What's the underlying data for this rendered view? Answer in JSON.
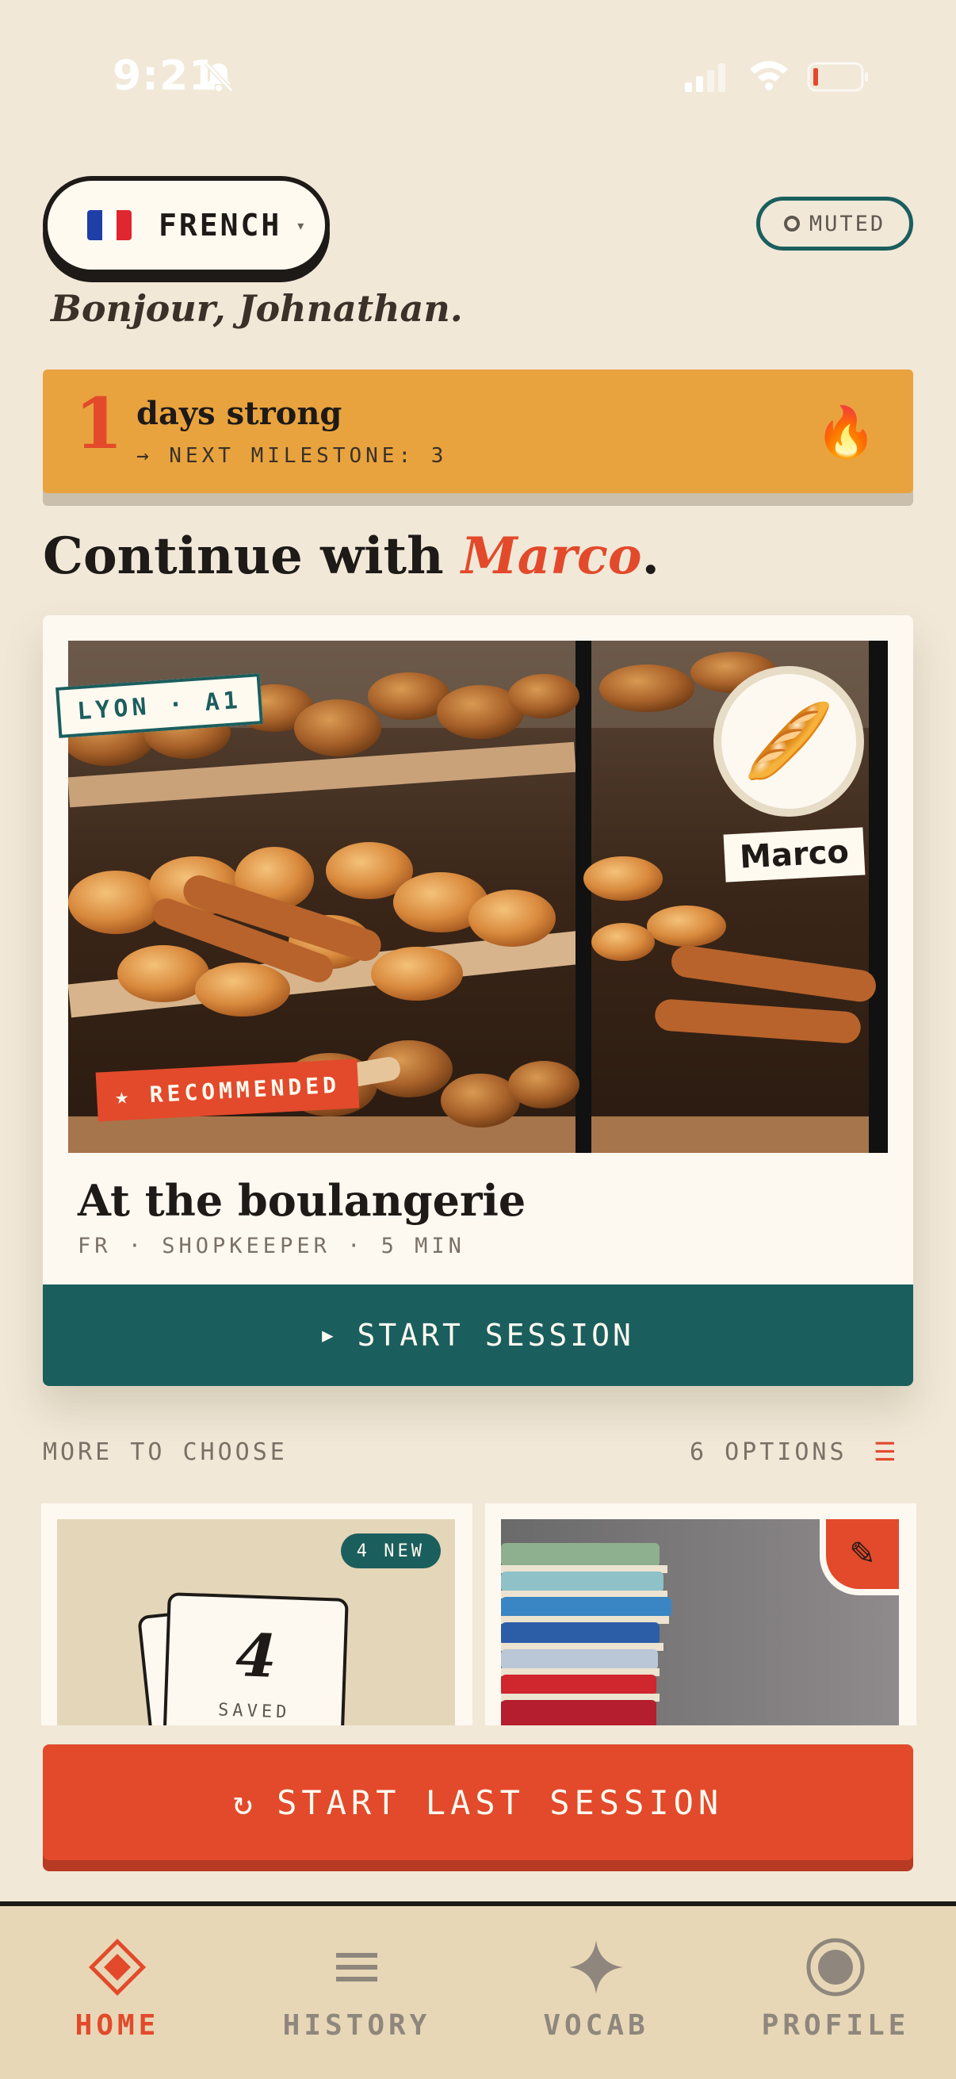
{
  "status_bar": {
    "time": "9:21"
  },
  "language": {
    "flag": "French flag",
    "label": "FRENCH"
  },
  "sound": {
    "label": "MUTED"
  },
  "greeting": "Bonjour, Johnathan.",
  "streak": {
    "count": "1",
    "title": "days strong",
    "next_milestone": "→ NEXT MILESTONE: 3"
  },
  "continue": {
    "prefix": "Continue with ",
    "tutor": "Marco",
    "suffix": "."
  },
  "featured": {
    "level_tag": "LYON · A1",
    "tutor_name": "Marco",
    "recommended": "★ RECOMMENDED",
    "title": "At the boulangerie",
    "meta": "FR · SHOPKEEPER · 5 MIN",
    "start_label": "START SESSION"
  },
  "more": {
    "label": "MORE TO CHOOSE",
    "count": "6 OPTIONS",
    "options": [
      {
        "badge": "4 NEW",
        "saved_count": "4",
        "saved_label": "SAVED"
      },
      {
        "icon": "pencil-icon"
      }
    ]
  },
  "last_session": {
    "label": "START LAST SESSION"
  },
  "nav": {
    "items": [
      {
        "label": "HOME",
        "icon": "diamond-icon",
        "active": true
      },
      {
        "label": "HISTORY",
        "icon": "list-icon",
        "active": false
      },
      {
        "label": "VOCAB",
        "icon": "sparkle-icon",
        "active": false
      },
      {
        "label": "PROFILE",
        "icon": "profile-icon",
        "active": false
      }
    ]
  },
  "colors": {
    "background": "#f1e8d8",
    "accent_red": "#e24a2b",
    "teal": "#1b5e5e",
    "streak_yellow": "#e9a33e"
  }
}
